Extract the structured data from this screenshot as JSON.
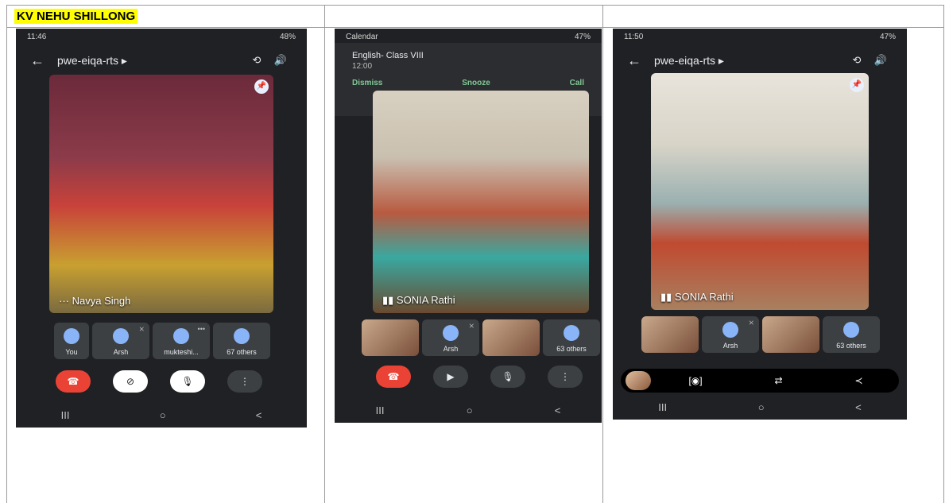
{
  "heading": "KV NEHU SHILLONG",
  "phone1": {
    "status_time": "11:46",
    "status_right": "48%",
    "meeting": "pwe-eiqa-rts ▸",
    "speaker": "Navya Singh",
    "tiles": [
      {
        "label": "You"
      },
      {
        "label": "Arsh"
      },
      {
        "label": "mukteshi..."
      },
      {
        "label": "67 others"
      }
    ],
    "nav": [
      "III",
      "○",
      "<"
    ]
  },
  "phone2": {
    "status_left": "Calendar",
    "status_right": "47%",
    "notif_title": "English- Class VIII",
    "notif_time": "12:00",
    "dismiss": "Dismiss",
    "snooze": "Snooze",
    "call": "Call",
    "speaker": "SONIA Rathi",
    "tiles": [
      {
        "label": ""
      },
      {
        "label": "Arsh"
      },
      {
        "label": ""
      },
      {
        "label": "63 others"
      }
    ],
    "nav": [
      "III",
      "○",
      "<"
    ]
  },
  "phone3": {
    "status_time": "11:50",
    "status_right": "47%",
    "meeting": "pwe-eiqa-rts ▸",
    "speaker": "SONIA Rathi",
    "tiles": [
      {
        "label": ""
      },
      {
        "label": "Arsh"
      },
      {
        "label": ""
      },
      {
        "label": "63 others"
      }
    ],
    "nav": [
      "III",
      "○",
      "<"
    ]
  },
  "colors": {
    "highlight": "#ffff00",
    "end_call": "#ea4335",
    "app_bg": "#202124"
  },
  "icons": [
    "back-arrow-icon",
    "switch-camera-icon",
    "speaker-icon",
    "pin-icon",
    "end-call-icon",
    "camera-off-icon",
    "mic-off-icon",
    "more-icon",
    "share-icon"
  ]
}
